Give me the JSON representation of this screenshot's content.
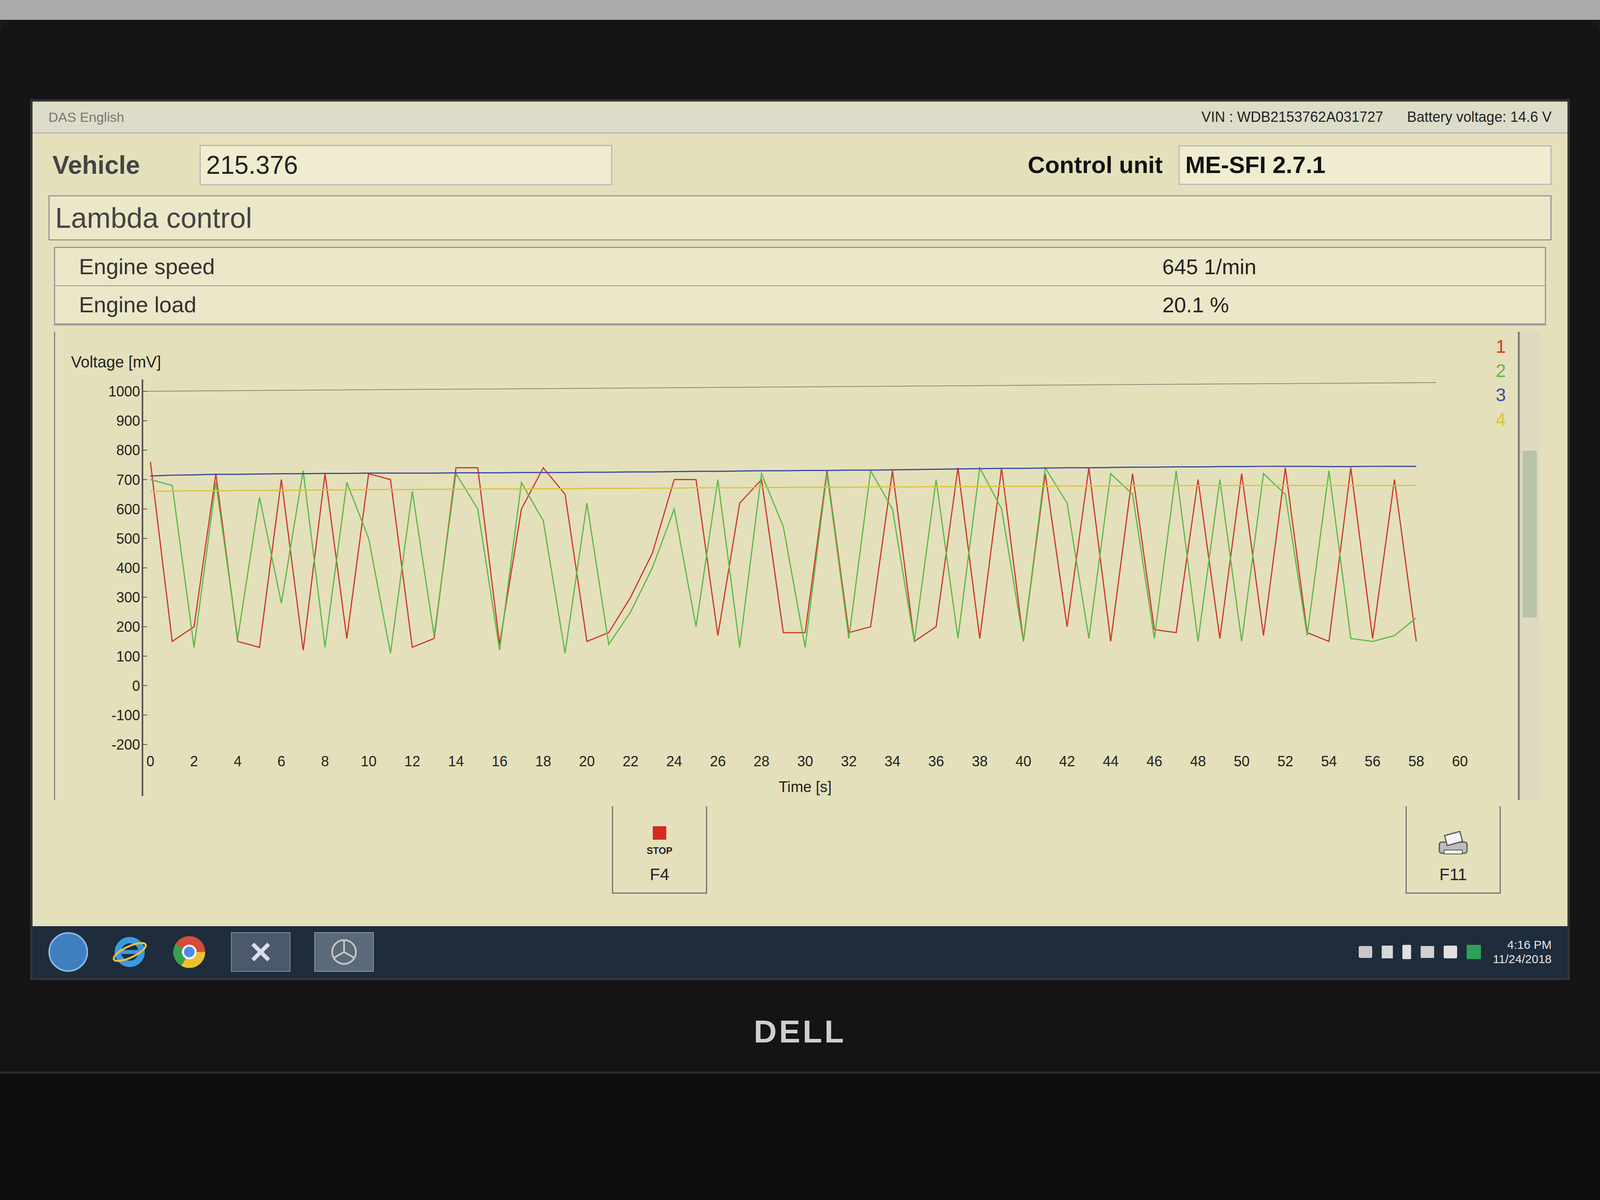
{
  "window": {
    "title": "DAS English",
    "vin": "VIN : WDB2153762A031727",
    "battery": "Battery voltage: 14.6 V"
  },
  "vehicle": {
    "label": "Vehicle",
    "value": "215.376"
  },
  "control_unit": {
    "label": "Control unit",
    "value": "ME-SFI 2.7.1"
  },
  "section": "Lambda control",
  "readings": [
    {
      "label": "Engine speed",
      "value": "645 1/min"
    },
    {
      "label": "Engine load",
      "value": "20.1 %"
    }
  ],
  "chart": {
    "y_label": "Voltage [mV]",
    "x_label": "Time [s]",
    "y_ticks": [
      "1000",
      "900",
      "800",
      "700",
      "600",
      "500",
      "400",
      "300",
      "200",
      "100",
      "0",
      "-100",
      "-200"
    ],
    "x_ticks": [
      "0",
      "2",
      "4",
      "6",
      "8",
      "10",
      "12",
      "14",
      "16",
      "18",
      "20",
      "22",
      "24",
      "26",
      "28",
      "30",
      "32",
      "34",
      "36",
      "38",
      "40",
      "42",
      "44",
      "46",
      "48",
      "50",
      "52",
      "54",
      "56",
      "58",
      "60"
    ],
    "series": [
      {
        "name": "1",
        "color": "#cc3a2c",
        "values": [
          760,
          150,
          200,
          720,
          150,
          130,
          700,
          120,
          720,
          160,
          720,
          700,
          130,
          160,
          740,
          740,
          140,
          600,
          740,
          650,
          150,
          180,
          300,
          450,
          700,
          700,
          170,
          620,
          700,
          180,
          180,
          730,
          180,
          200,
          730,
          150,
          200,
          740,
          160,
          740,
          150,
          720,
          200,
          740,
          150,
          720,
          190,
          180,
          700,
          160,
          720,
          170,
          740,
          180,
          150,
          740,
          160,
          700,
          150
        ]
      },
      {
        "name": "2",
        "color": "#5fb84a",
        "values": [
          700,
          680,
          130,
          690,
          160,
          640,
          280,
          730,
          130,
          690,
          500,
          110,
          660,
          170,
          720,
          600,
          120,
          690,
          560,
          110,
          620,
          140,
          250,
          400,
          600,
          200,
          700,
          130,
          720,
          540,
          130,
          720,
          160,
          730,
          600,
          150,
          700,
          160,
          740,
          600,
          150,
          740,
          620,
          160,
          720,
          650,
          160,
          730,
          150,
          700,
          150,
          720,
          650,
          170,
          730,
          160,
          150,
          170,
          230
        ]
      },
      {
        "name": "3",
        "color": "#3a4aa0",
        "values": [
          712,
          715,
          716,
          718,
          718,
          719,
          720,
          720,
          721,
          721,
          722,
          722,
          722,
          722,
          723,
          723,
          723,
          724,
          724,
          724,
          725,
          725,
          726,
          726,
          727,
          728,
          728,
          729,
          730,
          730,
          731,
          731,
          732,
          732,
          733,
          734,
          735,
          736,
          737,
          738,
          738,
          739,
          740,
          740,
          741,
          742,
          742,
          743,
          743,
          744,
          744,
          745,
          745,
          745,
          744,
          744,
          745,
          745,
          745
        ]
      },
      {
        "name": "4",
        "color": "#d9c43a",
        "values": [
          660,
          661,
          662,
          662,
          663,
          663,
          664,
          664,
          665,
          665,
          666,
          666,
          666,
          667,
          667,
          668,
          668,
          668,
          669,
          669,
          670,
          670,
          670,
          671,
          671,
          672,
          672,
          672,
          673,
          673,
          674,
          674,
          674,
          675,
          675,
          675,
          676,
          676,
          676,
          677,
          677,
          677,
          678,
          678,
          678,
          679,
          679,
          679,
          680,
          680,
          680,
          680,
          680,
          680,
          680,
          680,
          680,
          680,
          680
        ]
      }
    ]
  },
  "buttons": [
    {
      "key": "F4",
      "label": "STOP",
      "kind": "stop"
    },
    {
      "key": "F11",
      "label": "",
      "kind": "print"
    }
  ],
  "taskbar": {
    "time": "4:16 PM",
    "date": "11/24/2018"
  },
  "brand": "DELL"
}
